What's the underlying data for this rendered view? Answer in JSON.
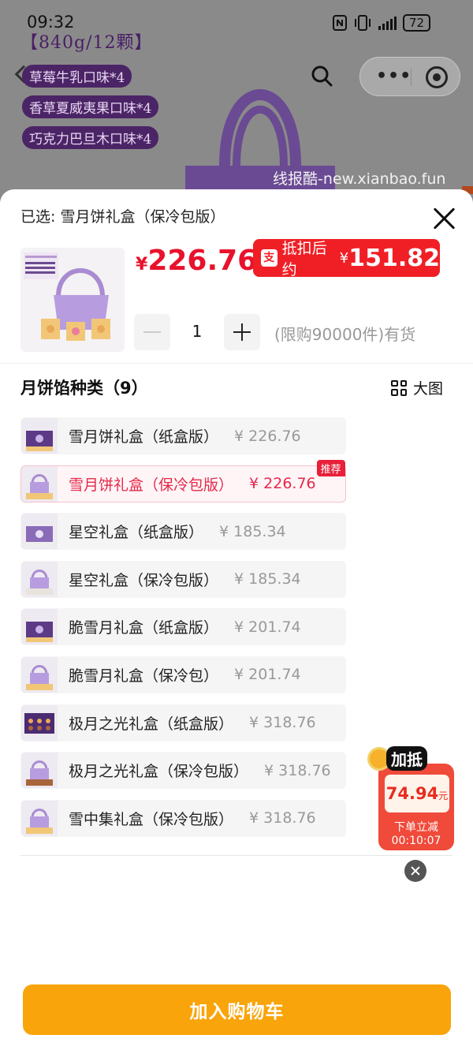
{
  "background_page": {
    "product_weight_title": "【840g/12颗】",
    "flavor_tags": [
      "草莓牛乳口味*4",
      "香草夏威夷果口味*4",
      "巧克力巴旦木口味*4"
    ],
    "watermark": "线报酷-new.xianbao.fun",
    "capsule_dots": "•••"
  },
  "status_bar": {
    "time": "09:32",
    "icons": [
      "nfc-icon",
      "vibrate-icon",
      "signal-icon"
    ],
    "battery": "72"
  },
  "sheet": {
    "selected_prefix": "已选:",
    "selected_value": "雪月饼礼盒（保冷包版）",
    "price_symbol": "¥",
    "price": "226.76",
    "discount": {
      "label": "抵扣后约",
      "symbol": "¥",
      "value": "151.82",
      "icon": "alipay-icon"
    },
    "quantity": "1",
    "stock_text": "(限购90000件)有货",
    "section_title": "月饼馅种类（9）",
    "view_toggle_label": "大图",
    "variants": [
      {
        "name": "雪月饼礼盒（纸盒版）",
        "price": "¥ 226.76"
      },
      {
        "name": "雪月饼礼盒（保冷包版）",
        "price": "¥ 226.76",
        "badge": "推荐"
      },
      {
        "name": "星空礼盒（纸盒版）",
        "price": "¥ 185.34"
      },
      {
        "name": "星空礼盒（保冷包版）",
        "price": "¥ 185.34"
      },
      {
        "name": "脆雪月礼盒（纸盒版）",
        "price": "¥ 201.74"
      },
      {
        "name": "脆雪月礼盒（保冷包）",
        "price": "¥ 201.74"
      },
      {
        "name": "极月之光礼盒（纸盒版）",
        "price": "¥ 318.76"
      },
      {
        "name": "极月之光礼盒（保冷包版）",
        "price": "¥ 318.76"
      },
      {
        "name": "雪中集礼盒（保冷包版）",
        "price": "¥ 318.76"
      }
    ],
    "coupon": {
      "tag": "加抵",
      "amount": "74.94",
      "unit": "元",
      "desc": "下单立减",
      "countdown": "00:10:07"
    },
    "add_to_cart_label": "加入购物车"
  },
  "colors": {
    "price_red": "#e8122c",
    "discount_bg": "#f01f26",
    "selected_text": "#e6284a",
    "cart_button": "#f9a40a",
    "bag_purple": "#a98bd2"
  }
}
